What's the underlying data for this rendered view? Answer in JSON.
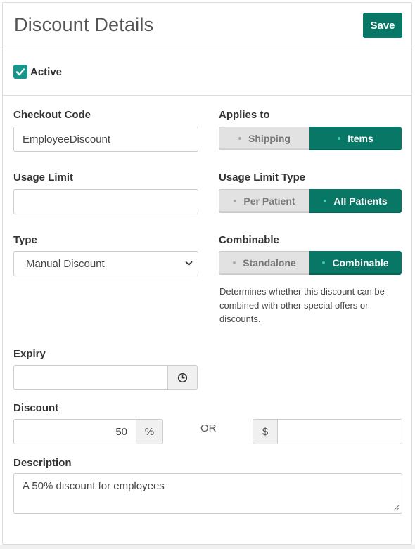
{
  "header": {
    "title": "Discount Details",
    "save_label": "Save"
  },
  "active": {
    "label": "Active",
    "checked": true
  },
  "checkout_code": {
    "label": "Checkout Code",
    "value": "EmployeeDiscount"
  },
  "applies_to": {
    "label": "Applies to",
    "options": [
      "Shipping",
      "Items"
    ],
    "selected": "Items"
  },
  "usage_limit": {
    "label": "Usage Limit",
    "value": ""
  },
  "usage_limit_type": {
    "label": "Usage Limit Type",
    "options": [
      "Per Patient",
      "All Patients"
    ],
    "selected": "All Patients"
  },
  "type": {
    "label": "Type",
    "value": "Manual Discount"
  },
  "combinable": {
    "label": "Combinable",
    "options": [
      "Standalone",
      "Combinable"
    ],
    "selected": "Combinable",
    "help": "Determines whether this discount can be combined with other special offers or discounts."
  },
  "expiry": {
    "label": "Expiry",
    "value": "",
    "icon": "clock-icon"
  },
  "discount": {
    "label": "Discount",
    "percent_value": "50",
    "percent_symbol": "%",
    "or_label": "OR",
    "dollar_symbol": "$",
    "dollar_value": ""
  },
  "description": {
    "label": "Description",
    "value": "A 50% discount for employees"
  },
  "colors": {
    "accent": "#087766",
    "checkbox": "#17958a"
  }
}
